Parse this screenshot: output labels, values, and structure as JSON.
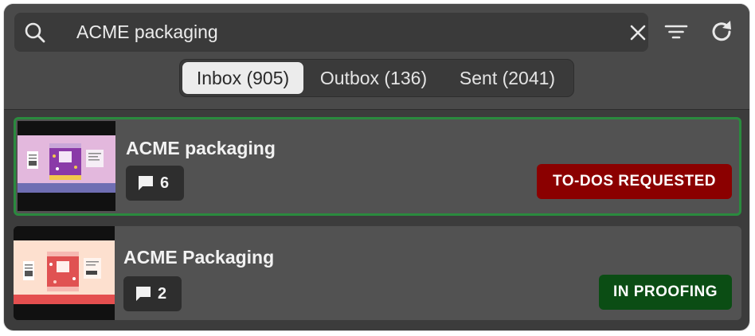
{
  "search": {
    "value": "ACME packaging",
    "placeholder": ""
  },
  "tabs": [
    {
      "label": "Inbox (905)",
      "active": true
    },
    {
      "label": "Outbox (136)",
      "active": false
    },
    {
      "label": "Sent (2041)",
      "active": false
    }
  ],
  "toolbar": {
    "search_icon": "search-icon",
    "clear_icon": "close-icon",
    "filter_icon": "filter-icon",
    "refresh_icon": "refresh-icon"
  },
  "items": [
    {
      "title": "ACME packaging",
      "comments": "6",
      "status": "TO-DOS REQUESTED",
      "status_color": "#8b0000",
      "selected": true,
      "selected_border": "#2a8a3e"
    },
    {
      "title": "ACME Packaging",
      "comments": "2",
      "status": "IN PROOFING",
      "status_color": "#0b4d14",
      "selected": false
    }
  ],
  "colors": {
    "panel": "#3c3c3c",
    "topbar": "#4a4a4a",
    "card": "#525252"
  }
}
